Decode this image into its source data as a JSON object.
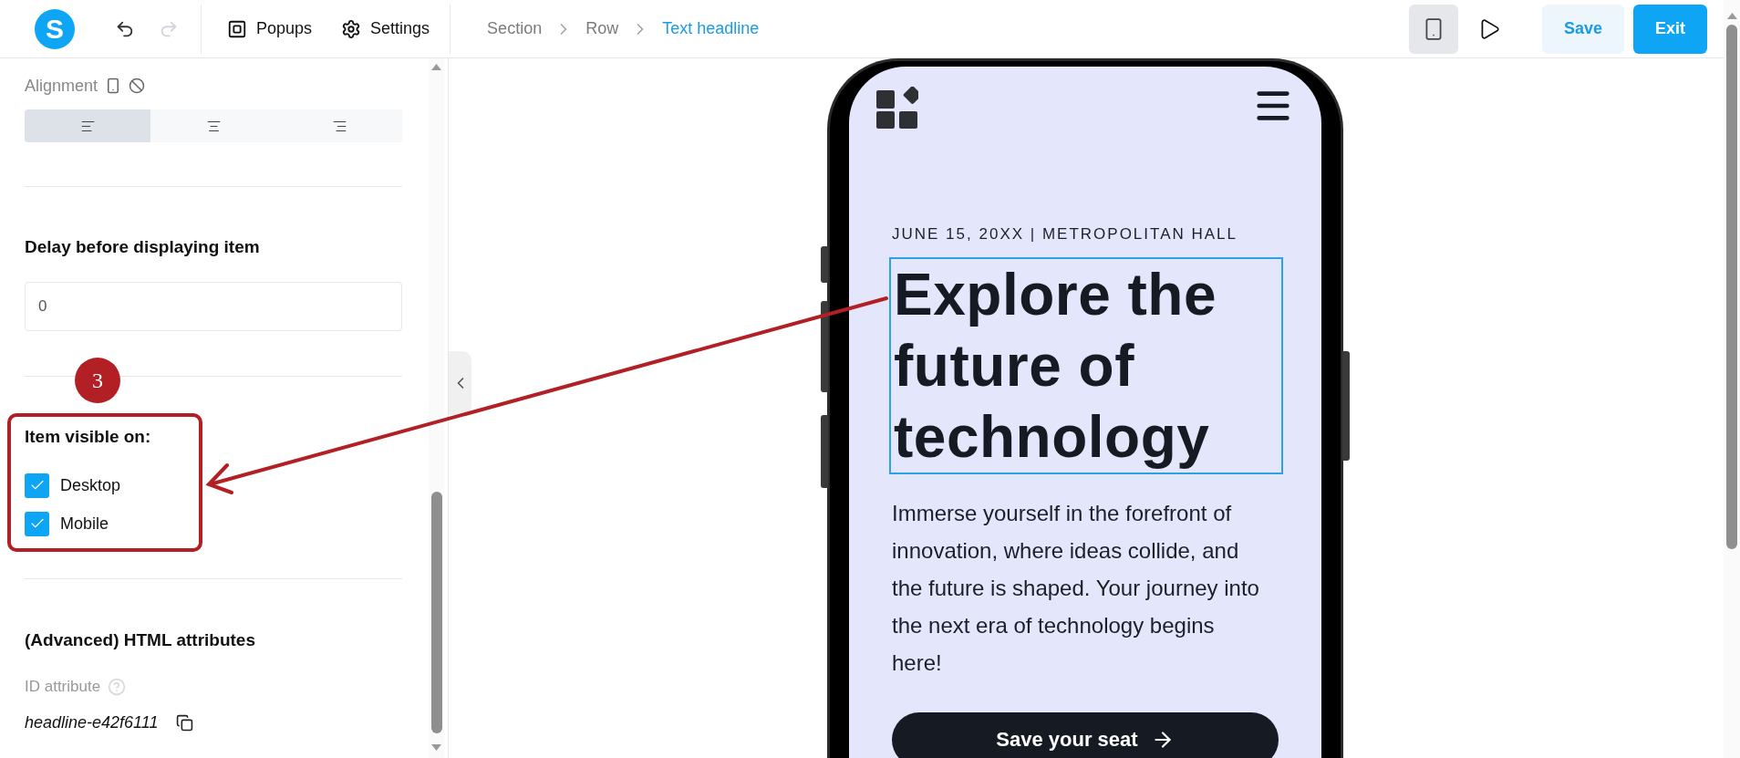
{
  "toolbar": {
    "logo": "S",
    "history": [
      {
        "kind": "undo",
        "disabled": false
      },
      {
        "kind": "redo",
        "disabled": true
      }
    ],
    "menu": [
      {
        "kind": "popups",
        "label": "Popups"
      },
      {
        "kind": "settings",
        "label": "Settings"
      }
    ],
    "breadcrumb": [
      {
        "label": "Section",
        "selected": false
      },
      {
        "label": "Row",
        "selected": false
      },
      {
        "label": "Text headline",
        "selected": true
      }
    ],
    "device_preview": {
      "selected": true
    },
    "buttons": [
      {
        "kind": "secondary",
        "label": "Save"
      },
      {
        "kind": "primary",
        "label": "Exit"
      }
    ]
  },
  "panel": {
    "alignment": {
      "label": "Alignment",
      "options": [
        {
          "kind": "left",
          "selected": true
        },
        {
          "kind": "center",
          "selected": false
        },
        {
          "kind": "right",
          "selected": false
        }
      ]
    },
    "delay": {
      "label": "Delay before displaying item",
      "value": "0"
    },
    "visibility": {
      "label": "Item visible on:",
      "options": [
        {
          "label": "Desktop",
          "checked": true
        },
        {
          "label": "Mobile",
          "checked": true
        }
      ]
    },
    "advanced": {
      "title": "(Advanced) HTML attributes",
      "id_label": "ID attribute",
      "id_value": "headline-e42f6111"
    }
  },
  "preview": {
    "eyebrow": "JUNE 15, 20XX | METROPOLITAN HALL",
    "headline": "Explore the future of technology",
    "headline_selected": true,
    "body": "Immerse yourself in the forefront of innovation, where ideas collide, and the future is shaped. Your journey into the next era of technology begins here!",
    "cta": "Save your seat"
  },
  "annotation": {
    "step": "3"
  }
}
